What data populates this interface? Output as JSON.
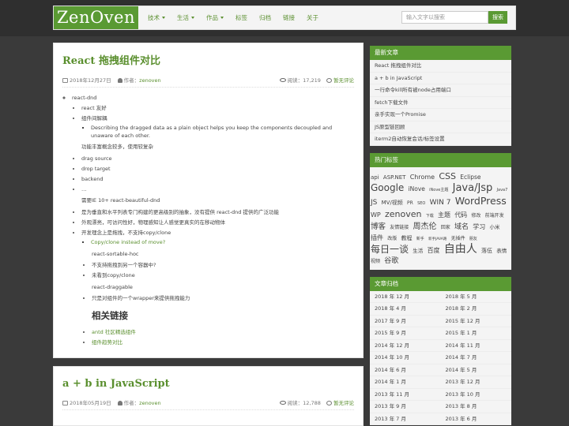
{
  "header": {
    "brand": "ZenOven",
    "nav": [
      {
        "label": "技术",
        "dropdown": true
      },
      {
        "label": "生活",
        "dropdown": true
      },
      {
        "label": "作品",
        "dropdown": true
      },
      {
        "label": "标签",
        "dropdown": false
      },
      {
        "label": "归档",
        "dropdown": false
      },
      {
        "label": "链接",
        "dropdown": false
      },
      {
        "label": "关于",
        "dropdown": false
      }
    ],
    "search_placeholder": "输入文字以搜索",
    "search_button": "搜索"
  },
  "articles": [
    {
      "title": "React 拖拽组件对比",
      "date": "2018年12月27日",
      "author_label": "作者：",
      "author": "zenoven",
      "views": "阅读：17,219",
      "comments": "暂无评论",
      "content": {
        "item1": "react-dnd",
        "item1a": "react 友好",
        "item1b": "组件间解耦",
        "item1b1": "Describing the dragged data as a plain object helps you keep the components decoupled and unaware of each other.",
        "p1": "功能丰富概念较多，使用较复杂",
        "list2": [
          "drag source",
          "drop target",
          "backend",
          "…"
        ],
        "p2": "需要IE 10+ react-beautiful-dnd",
        "list3": [
          "是为垂直和水平列表专门构建的更高级别的抽象，没有提供 react-dnd 提供的广泛功能",
          "外观漂亮，可访问性好，物理感知让人感觉更真实的在移动物体",
          "开发理念上是拖拽，不支持copy/clone"
        ],
        "link1": "Copy/clone instead of move?",
        "p3": "react-sortable-hoc",
        "list4": [
          "不支持拖拽到另一个容器中?",
          "未看到copy/clone"
        ],
        "p4": "react-draggable",
        "list5": [
          "只是对组件的一个wrapper来提供拖拽能力"
        ],
        "h3": "相关链接",
        "links": [
          "antd 社区精选组件",
          "组件趋势对比"
        ]
      }
    },
    {
      "title": "a + b in JavaScript",
      "date": "2018年05月19日",
      "author_label": "作者：",
      "author": "zenoven",
      "views": "阅读：12,788",
      "comments": "暂无评论"
    }
  ],
  "sidebar": {
    "recent_title": "最新文章",
    "recent": [
      "React 拖拽组件对比",
      "a + b in JavaScript",
      "一行命令kill所有被node占用端口",
      "fetch下载文件",
      "亲手实现一个Promise",
      "JS原型链回顾",
      "iterm2自动恢复会话/标签设置"
    ],
    "tags_title": "热门标签",
    "tags": [
      {
        "t": "api",
        "s": 7
      },
      {
        "t": "ASP.NET",
        "s": 7
      },
      {
        "t": "Chrome",
        "s": 8
      },
      {
        "t": "CSS",
        "s": 11
      },
      {
        "t": "Eclipse",
        "s": 7.5
      },
      {
        "t": "Google",
        "s": 12
      },
      {
        "t": "iNove",
        "s": 7.5
      },
      {
        "t": "iNove主题",
        "s": 5
      },
      {
        "t": "Java/Jsp",
        "s": 13
      },
      {
        "t": "Java7",
        "s": 5
      },
      {
        "t": "JS",
        "s": 9
      },
      {
        "t": "MV/视频",
        "s": 7
      },
      {
        "t": "PR",
        "s": 6
      },
      {
        "t": "SEO",
        "s": 5
      },
      {
        "t": "WIN 7",
        "s": 9
      },
      {
        "t": "WordPress",
        "s": 12.5
      },
      {
        "t": "WP",
        "s": 8
      },
      {
        "t": "zenoven",
        "s": 11
      },
      {
        "t": "下载",
        "s": 5
      },
      {
        "t": "主题",
        "s": 8
      },
      {
        "t": "代码",
        "s": 8
      },
      {
        "t": "修改",
        "s": 6
      },
      {
        "t": "前端开发",
        "s": 6
      },
      {
        "t": "博客",
        "s": 9.5
      },
      {
        "t": "友情链接",
        "s": 6
      },
      {
        "t": "周杰伦",
        "s": 10
      },
      {
        "t": "回家",
        "s": 6
      },
      {
        "t": "域名",
        "s": 9
      },
      {
        "t": "学习",
        "s": 8
      },
      {
        "t": "小米",
        "s": 6.5
      },
      {
        "t": "插件",
        "s": 8
      },
      {
        "t": "改版",
        "s": 6
      },
      {
        "t": "教程",
        "s": 7
      },
      {
        "t": "新手",
        "s": 5
      },
      {
        "t": "新手JAVA路",
        "s": 4.5
      },
      {
        "t": "无插件",
        "s": 6
      },
      {
        "t": "朋友",
        "s": 5
      },
      {
        "t": "每日一谈",
        "s": 12
      },
      {
        "t": "生活",
        "s": 6.5
      },
      {
        "t": "百度",
        "s": 8
      },
      {
        "t": "自由人",
        "s": 14
      },
      {
        "t": "落伍",
        "s": 7
      },
      {
        "t": "表情",
        "s": 6.5
      },
      {
        "t": "视频",
        "s": 6
      },
      {
        "t": "谷歌",
        "s": 9
      }
    ],
    "archive_title": "文章归档",
    "archive": [
      "2018 年 12 月",
      "2018 年 5 月",
      "2018 年 4 月",
      "2018 年 2 月",
      "2017 年 9 月",
      "2015 年 12 月",
      "2015 年 9 月",
      "2015 年 1 月",
      "2014 年 12 月",
      "2014 年 11 月",
      "2014 年 10 月",
      "2014 年 7 月",
      "2014 年 6 月",
      "2014 年 5 月",
      "2014 年 1 月",
      "2013 年 12 月",
      "2013 年 11 月",
      "2013 年 10 月",
      "2013 年 9 月",
      "2013 年 8 月",
      "2013 年 7 月",
      "2013 年 6 月"
    ]
  }
}
